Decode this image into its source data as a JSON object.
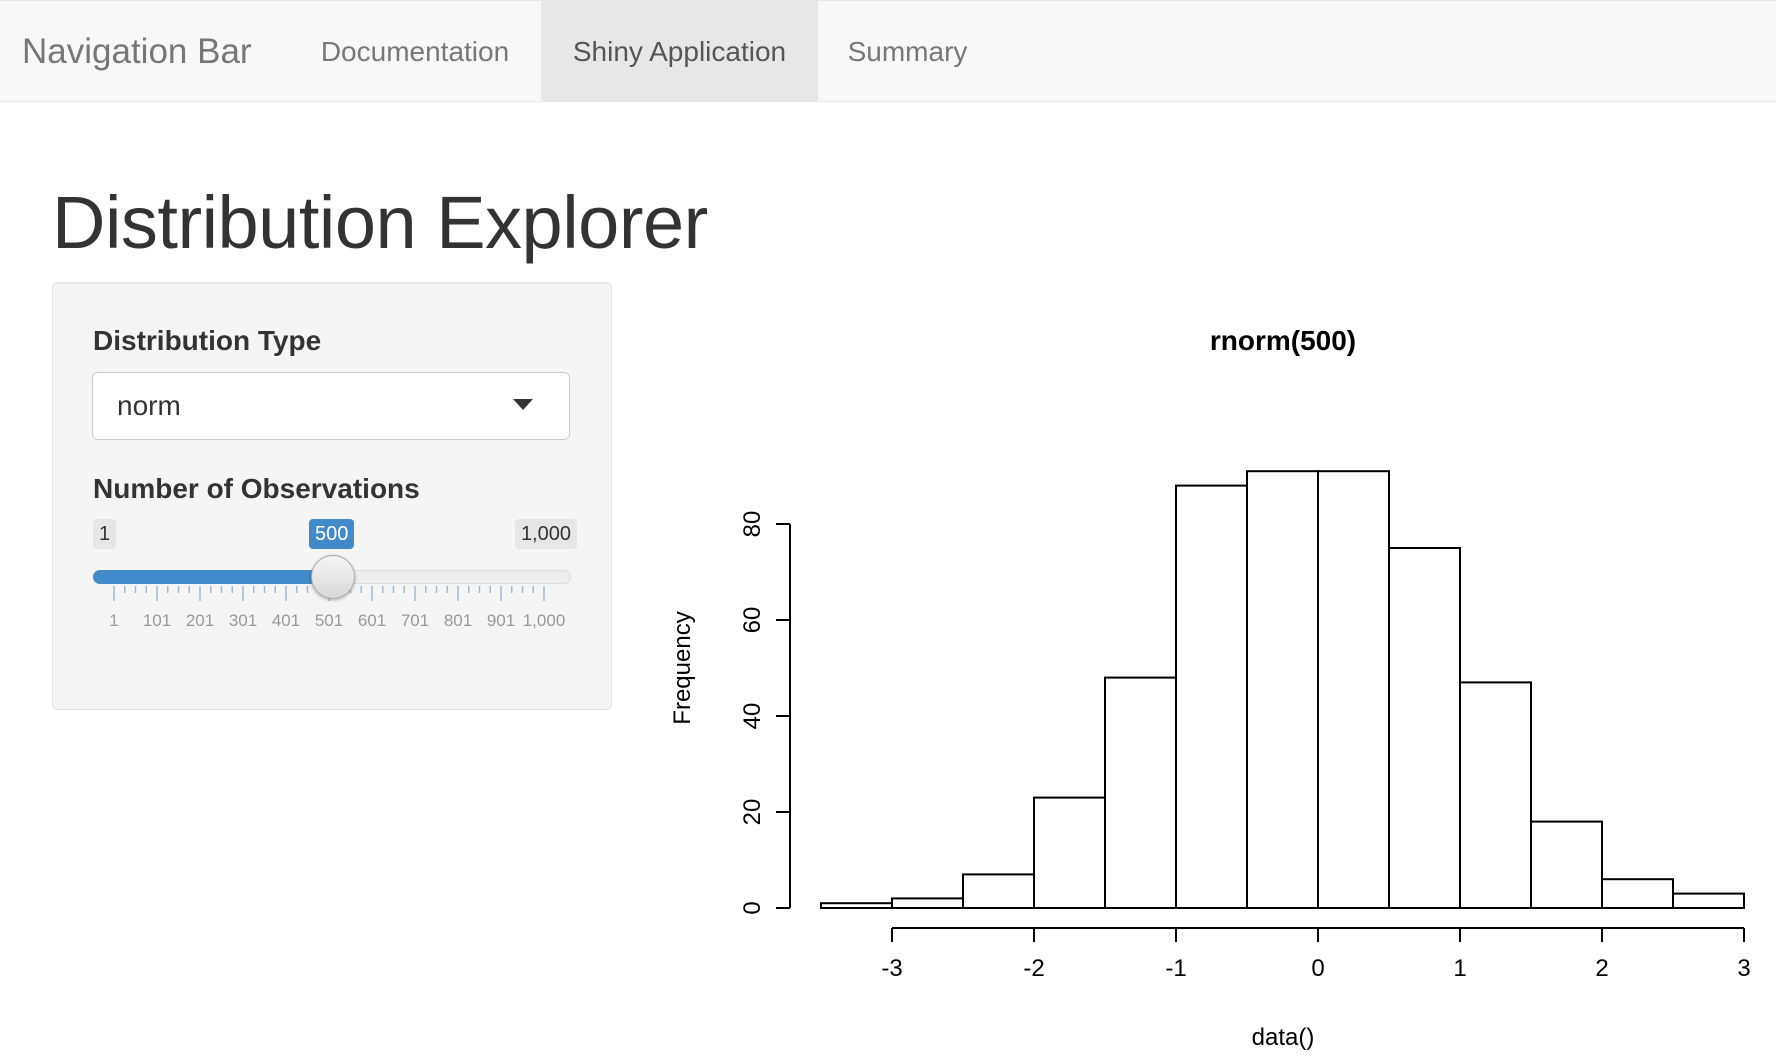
{
  "navbar": {
    "brand": "Navigation Bar",
    "tabs": [
      {
        "label": "Documentation",
        "active": false
      },
      {
        "label": "Shiny Application",
        "active": true
      },
      {
        "label": "Summary",
        "active": false
      }
    ]
  },
  "page": {
    "title": "Distribution Explorer"
  },
  "sidebar": {
    "distribution_label": "Distribution Type",
    "distribution_value": "norm",
    "observations_label": "Number of Observations",
    "slider": {
      "min_label": "1",
      "max_label": "1,000",
      "current_label": "500",
      "min": 1,
      "max": 1000,
      "value": 500,
      "tick_labels": [
        "1",
        "101",
        "201",
        "301",
        "401",
        "501",
        "601",
        "701",
        "801",
        "901",
        "1,000"
      ]
    }
  },
  "colors": {
    "accent": "#428bca",
    "navbar_bg": "#f8f8f8",
    "active_tab_bg": "#e7e7e7",
    "well_bg": "#f5f5f5"
  },
  "icons": {
    "select_caret": "caret-down-icon"
  },
  "chart_data": {
    "type": "bar",
    "title": "rnorm(500)",
    "xlabel": "data()",
    "ylabel": "Frequency",
    "bins": [
      {
        "start": -3.5,
        "end": -3.0,
        "count": 1
      },
      {
        "start": -3.0,
        "end": -2.5,
        "count": 2
      },
      {
        "start": -2.5,
        "end": -2.0,
        "count": 7
      },
      {
        "start": -2.0,
        "end": -1.5,
        "count": 23
      },
      {
        "start": -1.5,
        "end": -1.0,
        "count": 48
      },
      {
        "start": -1.0,
        "end": -0.5,
        "count": 88
      },
      {
        "start": -0.5,
        "end": 0.0,
        "count": 91
      },
      {
        "start": 0.0,
        "end": 0.5,
        "count": 91
      },
      {
        "start": 0.5,
        "end": 1.0,
        "count": 75
      },
      {
        "start": 1.0,
        "end": 1.5,
        "count": 47
      },
      {
        "start": 1.5,
        "end": 2.0,
        "count": 18
      },
      {
        "start": 2.0,
        "end": 2.5,
        "count": 6
      },
      {
        "start": 2.5,
        "end": 3.0,
        "count": 3
      }
    ],
    "x_ticks": [
      -3,
      -2,
      -1,
      0,
      1,
      2,
      3
    ],
    "y_ticks": [
      0,
      20,
      40,
      60,
      80
    ],
    "xlim": [
      -3.5,
      3.0
    ],
    "ylim": [
      0,
      91
    ],
    "grid": false
  }
}
